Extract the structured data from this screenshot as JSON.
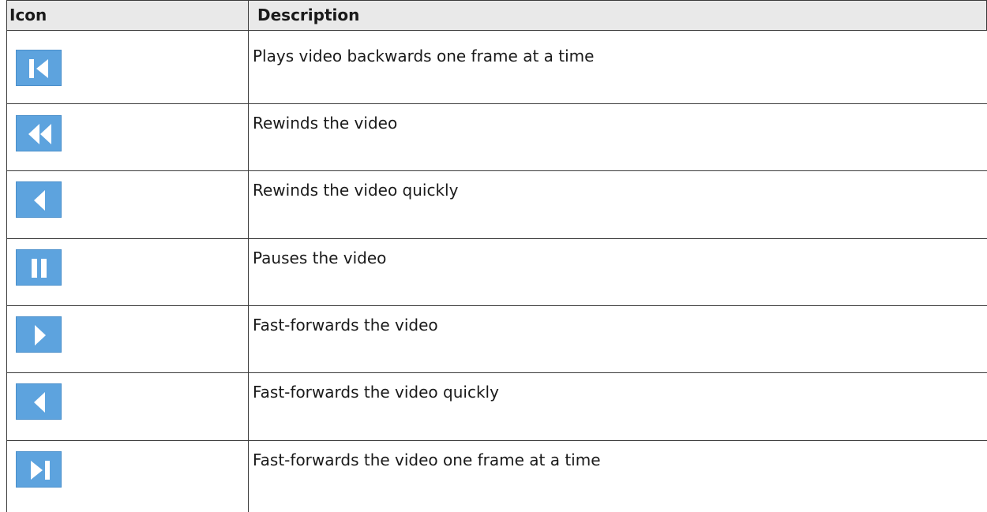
{
  "table": {
    "headers": {
      "icon": "Icon",
      "description": "Description"
    },
    "rows": [
      {
        "icon": "frame-backward-icon",
        "description": "Plays video backwards one frame at a time"
      },
      {
        "icon": "rewind-icon",
        "description": "Rewinds the video"
      },
      {
        "icon": "rewind-quick-icon",
        "description": "Rewinds the video quickly"
      },
      {
        "icon": "pause-icon",
        "description": "Pauses the video"
      },
      {
        "icon": "fast-forward-icon",
        "description": "Fast-forwards the video"
      },
      {
        "icon": "fast-forward-quick-icon",
        "description": "Fast-forwards the video quickly"
      },
      {
        "icon": "frame-forward-icon",
        "description": "Fast-forwards the video one frame at a time"
      }
    ]
  },
  "colors": {
    "icon_background": "#5da3de",
    "icon_glyph": "#ffffff",
    "header_background": "#e9e9e9",
    "rule": "#3a3a3a"
  }
}
